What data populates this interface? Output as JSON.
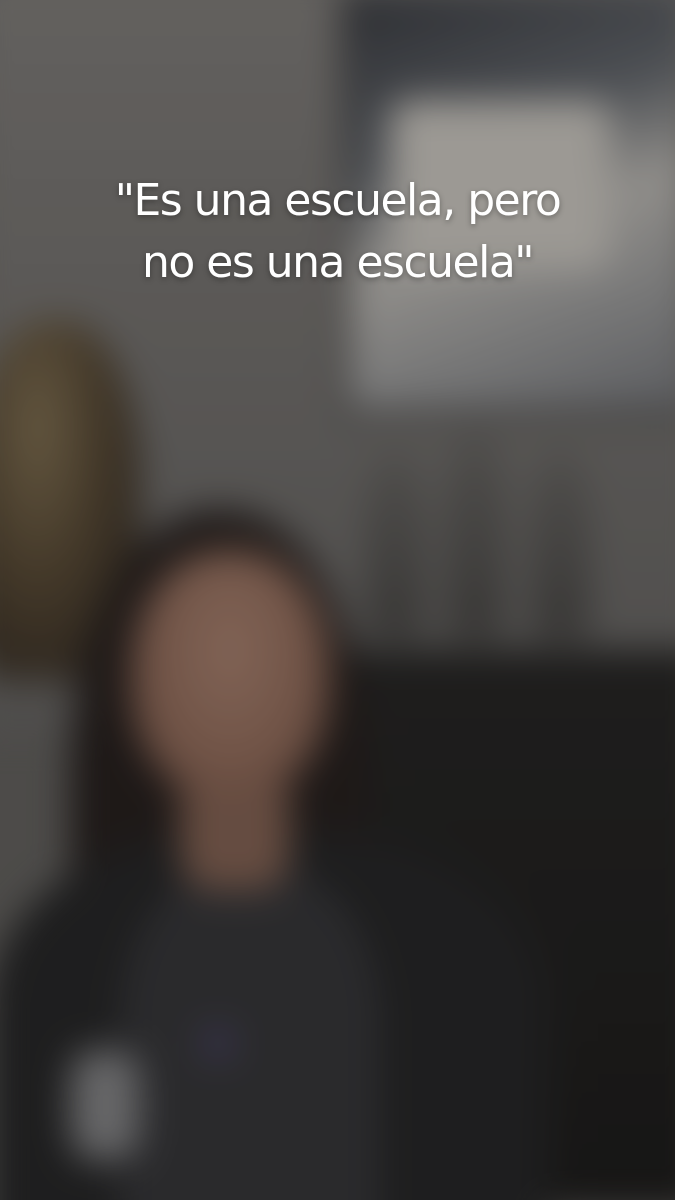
{
  "caption": {
    "line1": "\"Es una escuela, pero",
    "line2": "no es una escuela\""
  },
  "colors": {
    "caption_text": "#ffffff",
    "overlay": "rgba(0,0,0,0.28)"
  }
}
